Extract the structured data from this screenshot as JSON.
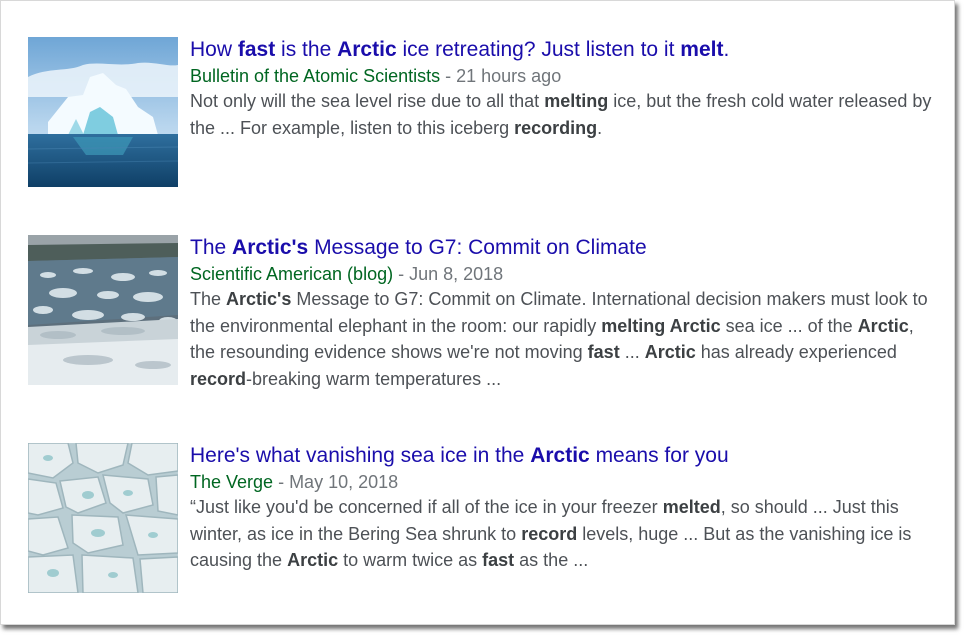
{
  "results": [
    {
      "title_parts": [
        {
          "t": "How ",
          "b": false
        },
        {
          "t": "fast",
          "b": true
        },
        {
          "t": " is the ",
          "b": false
        },
        {
          "t": "Arctic",
          "b": true
        },
        {
          "t": " ice retreating? Just listen to it ",
          "b": false
        },
        {
          "t": "melt",
          "b": true
        },
        {
          "t": ".",
          "b": false
        }
      ],
      "source": "Bulletin of the Atomic Scientists",
      "separator": " - ",
      "date": "21 hours ago",
      "snippet_parts": [
        {
          "t": "Not only will the sea level rise due to all that ",
          "b": false
        },
        {
          "t": "melting",
          "b": true
        },
        {
          "t": " ice, but the fresh cold water released by the ... For example, listen to this iceberg ",
          "b": false
        },
        {
          "t": "recording",
          "b": true
        },
        {
          "t": ".",
          "b": false
        }
      ],
      "image_icon": "iceberg-thumbnail"
    },
    {
      "title_parts": [
        {
          "t": "The ",
          "b": false
        },
        {
          "t": "Arctic's",
          "b": true
        },
        {
          "t": " Message to G7: Commit on Climate",
          "b": false
        }
      ],
      "source": "Scientific American (blog)",
      "separator": " - ",
      "date": "Jun 8, 2018",
      "snippet_parts": [
        {
          "t": "The ",
          "b": false
        },
        {
          "t": "Arctic's",
          "b": true
        },
        {
          "t": " Message to G7: Commit on Climate. International decision makers must look to the environmental elephant in the room: our rapidly ",
          "b": false
        },
        {
          "t": "melting Arctic",
          "b": true
        },
        {
          "t": " sea ice ... of the ",
          "b": false
        },
        {
          "t": "Arctic",
          "b": true
        },
        {
          "t": ", the resounding evidence shows we're not moving ",
          "b": false
        },
        {
          "t": "fast",
          "b": true
        },
        {
          "t": " ... ",
          "b": false
        },
        {
          "t": "Arctic",
          "b": true
        },
        {
          "t": " has already experienced ",
          "b": false
        },
        {
          "t": "record",
          "b": true
        },
        {
          "t": "-breaking warm temperatures ...",
          "b": false
        }
      ],
      "image_icon": "sea-ice-thumbnail"
    },
    {
      "title_parts": [
        {
          "t": "Here's what vanishing sea ice in the ",
          "b": false
        },
        {
          "t": "Arctic",
          "b": true
        },
        {
          "t": " means for you",
          "b": false
        }
      ],
      "source": "The Verge",
      "separator": " - ",
      "date": "May 10, 2018",
      "snippet_parts": [
        {
          "t": "“Just like you'd be concerned if all of the ice in your freezer ",
          "b": false
        },
        {
          "t": "melted",
          "b": true
        },
        {
          "t": ", so should ... Just this winter, as ice in the Bering Sea shrunk to ",
          "b": false
        },
        {
          "t": "record",
          "b": true
        },
        {
          "t": " levels, huge ... But as the vanishing ice is causing the ",
          "b": false
        },
        {
          "t": "Arctic",
          "b": true
        },
        {
          "t": " to warm twice as ",
          "b": false
        },
        {
          "t": "fast",
          "b": true
        },
        {
          "t": " as the ...",
          "b": false
        }
      ],
      "image_icon": "ice-floes-thumbnail"
    }
  ],
  "colors": {
    "title": "#1a0dab",
    "source": "#006621",
    "meta": "#70757a",
    "snippet": "#4d5156"
  }
}
